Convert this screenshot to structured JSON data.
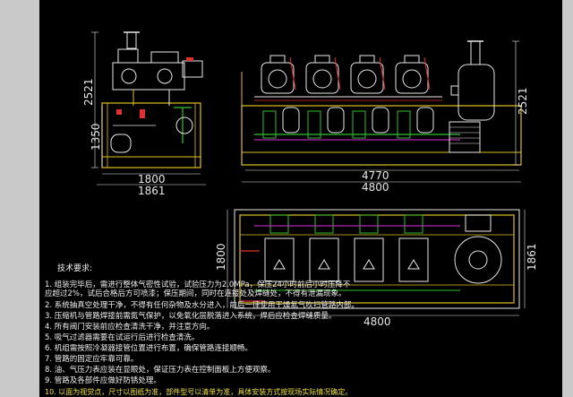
{
  "colors": {
    "background": "#000000",
    "frame": "#c9c9c9",
    "structure": "#e0c020",
    "equipment": "#e8e8e8",
    "pipe_green": "#30c030",
    "pipe_magenta": "#e030e0",
    "pipe_red": "#e03030",
    "dimension": "#e8e8e8"
  },
  "side_view": {
    "dim_height_total": "2521",
    "dim_height_sub": "1350",
    "dim_width_inner": "1800",
    "dim_width_outer": "1861"
  },
  "front_view": {
    "dim_height": "2521",
    "dim_width_inner": "4770",
    "dim_width_outer": "4800"
  },
  "plan_view": {
    "dim_height_left": "1800",
    "dim_height_right": "1861",
    "dim_width": "4800"
  },
  "notes": {
    "heading": "技术要求:",
    "lines": [
      "1.  组装完毕后，需进行整体气密性试验，试验压力为2.0MPa，保压24小时前后小时压降不",
      "    应超过2%，试后合格后方可喷漆；保压期间，同时在连接处及焊缝处，不得有泄漏现象。",
      "2.  系统抽真空处理干净，不得有任何杂物及水分进入，前后一律使用干燥氮气吹扫管路内部。",
      "3.  压缩机与管路焊接前需氮气保护，以免氧化层脱落进入系统，焊后应检查焊缝质量。",
      "4.  所有阀门安装前应检查清洗干净，并注意方向。",
      "5.  吸气过滤器需要在试运行后进行检查清洗。",
      "6.  机组需按照冷凝器接管位置进行布置，确保管路连接顺畅。",
      "7.  管路的固定应牢靠可靠。",
      "8.  油、气压力表应装在显眼处，保证压力表在控制面板上方便观察。",
      "9.  管路及各部件应做好防锈处理。"
    ],
    "last_line": "10. 以面为视觉点，尺寸以图纸为准，部件型号以清单为准，具体安装方式按现场实际情况确定。"
  }
}
